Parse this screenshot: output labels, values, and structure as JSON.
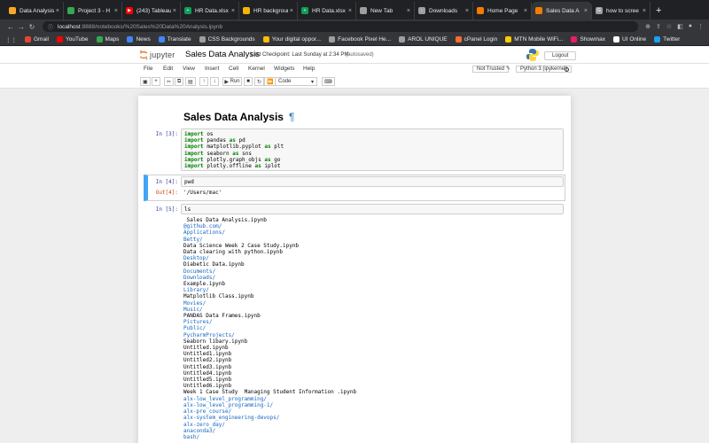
{
  "browser": {
    "tabs": [
      {
        "label": "Data Analysis",
        "fav_color": "#f9a825",
        "fav_glyph": "",
        "active": false
      },
      {
        "label": "Project 3 - H",
        "fav_color": "#34a853",
        "fav_glyph": "",
        "active": false
      },
      {
        "label": "(243) Tableau",
        "fav_color": "#ff0000",
        "fav_glyph": "▶",
        "active": false
      },
      {
        "label": "HR Data.xlsx",
        "fav_color": "#0f9d58",
        "fav_glyph": "+",
        "active": false
      },
      {
        "label": "HR background",
        "fav_color": "#f4b400",
        "fav_glyph": "",
        "active": false
      },
      {
        "label": "HR Data.xlsx",
        "fav_color": "#0f9d58",
        "fav_glyph": "+",
        "active": false
      },
      {
        "label": "New Tab",
        "fav_color": "#9e9e9e",
        "fav_glyph": "",
        "active": false
      },
      {
        "label": "Downloads",
        "fav_color": "#9e9e9e",
        "fav_glyph": "↓",
        "active": false
      },
      {
        "label": "Home Page",
        "fav_color": "#f57c00",
        "fav_glyph": "",
        "active": false
      },
      {
        "label": "Sales Data A",
        "fav_color": "#f57c00",
        "fav_glyph": "",
        "active": true
      },
      {
        "label": "how to scree",
        "fav_color": "#9e9e9e",
        "fav_glyph": "G",
        "active": false
      }
    ],
    "new_tab_glyph": "+",
    "url_host": "localhost",
    "url_path": ":8888/notebooks/%20Sales%20Data%20Analysis.ipynb",
    "bookmarks": [
      {
        "label": "Gmail",
        "color": "#ea4335"
      },
      {
        "label": "YouTube",
        "color": "#ff0000"
      },
      {
        "label": "Maps",
        "color": "#34a853"
      },
      {
        "label": "News",
        "color": "#4285f4"
      },
      {
        "label": "Translate",
        "color": "#4285f4"
      },
      {
        "label": "CSS Backgrounds",
        "color": "#9e9e9e"
      },
      {
        "label": "Your digital oppor...",
        "color": "#fbbc05"
      },
      {
        "label": "Facebook Pixel He...",
        "color": "#9e9e9e"
      },
      {
        "label": "AROL UNIQUE",
        "color": "#9e9e9e"
      },
      {
        "label": "cPanel Login",
        "color": "#ff6c2c"
      },
      {
        "label": "MTN Mobile WiFi...",
        "color": "#ffcc00"
      },
      {
        "label": "Showmax",
        "color": "#e91e63"
      },
      {
        "label": "UI Online",
        "color": "#ffffff"
      },
      {
        "label": "Twitter",
        "color": "#1da1f2"
      }
    ]
  },
  "jupyter": {
    "logo_text": "jupyter",
    "notebook_name": "Sales Data Analysis",
    "checkpoint": "Last Checkpoint: Last Sunday at 2:34 PM",
    "autosaved": "(autosaved)",
    "logout": "Logout",
    "menu": [
      "File",
      "Edit",
      "View",
      "Insert",
      "Cell",
      "Kernel",
      "Widgets",
      "Help"
    ],
    "trusted": "Not Trusted",
    "kernel": "Python 3 (ipykernel)",
    "toolbar": {
      "run": "Run",
      "cell_type": "Code"
    }
  },
  "cells": {
    "title": "Sales Data Analysis",
    "pilcrow": "¶",
    "cell1_prompt": "In [3]:",
    "cell2_prompt": "In [4]:",
    "cell2_code": "pwd",
    "cell2_out_prompt": "Out[4]:",
    "cell2_out": "'/Users/mac'",
    "cell3_prompt": "In [5]:",
    "cell3_code": "ls"
  },
  "imports": [
    {
      "kw": "import",
      "mod": "os",
      "as": "",
      "alias": ""
    },
    {
      "kw": "import",
      "mod": "pandas",
      "as": "as",
      "alias": "pd"
    },
    {
      "kw": "import",
      "mod": "matplotlib.pyplot",
      "as": "as",
      "alias": "plt"
    },
    {
      "kw": "import",
      "mod": "seaborn",
      "as": "as",
      "alias": "sns"
    },
    {
      "kw": "import",
      "mod": "plotly.graph_objs",
      "as": "as",
      "alias": "go"
    },
    {
      "kw": "import",
      "mod": "plotly.offline",
      "as": "as",
      "alias": "iplot"
    }
  ],
  "ls_output": [
    {
      "text": " Sales Data Analysis.ipynb",
      "dir": false
    },
    {
      "text": "@github.com/",
      "dir": true
    },
    {
      "text": "Applications/",
      "dir": true
    },
    {
      "text": "Betty/",
      "dir": true
    },
    {
      "text": "Data Science Week 2 Case Study.ipynb",
      "dir": false
    },
    {
      "text": "Data clearing with python.ipynb",
      "dir": false
    },
    {
      "text": "Desktop/",
      "dir": true
    },
    {
      "text": "Diabetic Data.ipynb",
      "dir": false
    },
    {
      "text": "Documents/",
      "dir": true
    },
    {
      "text": "Downloads/",
      "dir": true
    },
    {
      "text": "Example.ipynb",
      "dir": false
    },
    {
      "text": "Library/",
      "dir": true
    },
    {
      "text": "Matplotlib Class.ipynb",
      "dir": false
    },
    {
      "text": "Movies/",
      "dir": true
    },
    {
      "text": "Music/",
      "dir": true
    },
    {
      "text": "PANDAS Data Frames.ipynb",
      "dir": false
    },
    {
      "text": "Pictures/",
      "dir": true
    },
    {
      "text": "Public/",
      "dir": true
    },
    {
      "text": "PycharmProjects/",
      "dir": true
    },
    {
      "text": "Seaborn libary.ipynb",
      "dir": false
    },
    {
      "text": "Untitled.ipynb",
      "dir": false
    },
    {
      "text": "Untitled1.ipynb",
      "dir": false
    },
    {
      "text": "Untitled2.ipynb",
      "dir": false
    },
    {
      "text": "Untitled3.ipynb",
      "dir": false
    },
    {
      "text": "Untitled4.ipynb",
      "dir": false
    },
    {
      "text": "Untitled5.ipynb",
      "dir": false
    },
    {
      "text": "Untitled6.ipynb",
      "dir": false
    },
    {
      "text": "Week 1 Case Study  Managing Student Information .ipynb",
      "dir": false
    },
    {
      "text": "alx-low_level_programming/",
      "dir": true
    },
    {
      "text": "alx-low_level_programming-1/",
      "dir": true
    },
    {
      "text": "alx-pre_course/",
      "dir": true
    },
    {
      "text": "alx-system_engineering-devops/",
      "dir": true
    },
    {
      "text": "alx-zero_day/",
      "dir": true
    },
    {
      "text": "anaconda3/",
      "dir": true
    },
    {
      "text": "bash/",
      "dir": true
    }
  ]
}
